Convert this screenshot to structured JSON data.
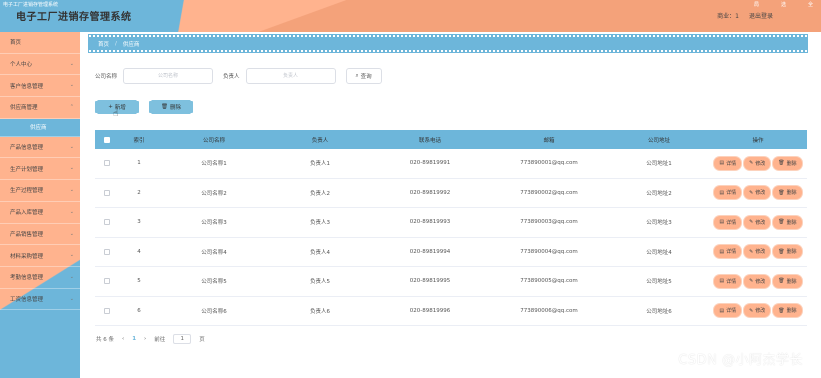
{
  "window": {
    "caption": "电子工厂进销存管理系统",
    "menu": [
      "局",
      "选",
      "全"
    ]
  },
  "header": {
    "title": "电子工厂进销存管理系统",
    "right_links": [
      "商业：1",
      "退出登录"
    ]
  },
  "sidebar": {
    "items": [
      {
        "label": "首页",
        "chevron": false
      },
      {
        "label": "个人中心",
        "chevron": true
      },
      {
        "label": "客户信息管理",
        "chevron": true
      },
      {
        "label": "供应商管理",
        "chevron": true
      },
      {
        "label": "供应商",
        "sub": true
      },
      {
        "label": "产品信息管理",
        "chevron": true
      },
      {
        "label": "生产计划管理",
        "chevron": true
      },
      {
        "label": "生产过程管理",
        "chevron": true
      },
      {
        "label": "产品入库管理",
        "chevron": true
      },
      {
        "label": "产品销售管理",
        "chevron": true
      },
      {
        "label": "材料采购管理",
        "chevron": true
      },
      {
        "label": "考勤信息管理",
        "chevron": true
      },
      {
        "label": "工资信息管理",
        "chevron": true
      }
    ]
  },
  "breadcrumb": {
    "home": "首页",
    "separator": "/",
    "current": "供应商"
  },
  "search": {
    "company_label": "公司名称",
    "company_placeholder": "公司名称",
    "person_label": "负责人",
    "person_placeholder": "负责人",
    "query_button": "查询"
  },
  "actions": {
    "add": "新增",
    "delete": "删除"
  },
  "table": {
    "headers": [
      "索引",
      "公司名称",
      "负责人",
      "联系电话",
      "邮箱",
      "公司地址",
      "操作"
    ],
    "rows": [
      [
        "1",
        "公司名称1",
        "负责人1",
        "020-89819991",
        "773890001@qq.com",
        "公司地址1"
      ],
      [
        "2",
        "公司名称2",
        "负责人2",
        "020-89819992",
        "773890002@qq.com",
        "公司地址2"
      ],
      [
        "3",
        "公司名称3",
        "负责人3",
        "020-89819993",
        "773890003@qq.com",
        "公司地址3"
      ],
      [
        "4",
        "公司名称4",
        "负责人4",
        "020-89819994",
        "773890004@qq.com",
        "公司地址4"
      ],
      [
        "5",
        "公司名称5",
        "负责人5",
        "020-89819995",
        "773890005@qq.com",
        "公司地址5"
      ],
      [
        "6",
        "公司名称6",
        "负责人6",
        "020-89819996",
        "773890006@qq.com",
        "公司地址6"
      ]
    ],
    "row_ops": [
      "详情",
      "修改",
      "删除"
    ]
  },
  "pager": {
    "total": "共 6 条",
    "prev": "‹",
    "page": "1",
    "next": "›",
    "goto_label": "前往",
    "goto_value": "1",
    "page_suffix": "页"
  },
  "watermark": "CSDN @小阿杰学长",
  "colors": {
    "primary_blue": "#6db6da",
    "primary_orange": "#ffb38e"
  }
}
